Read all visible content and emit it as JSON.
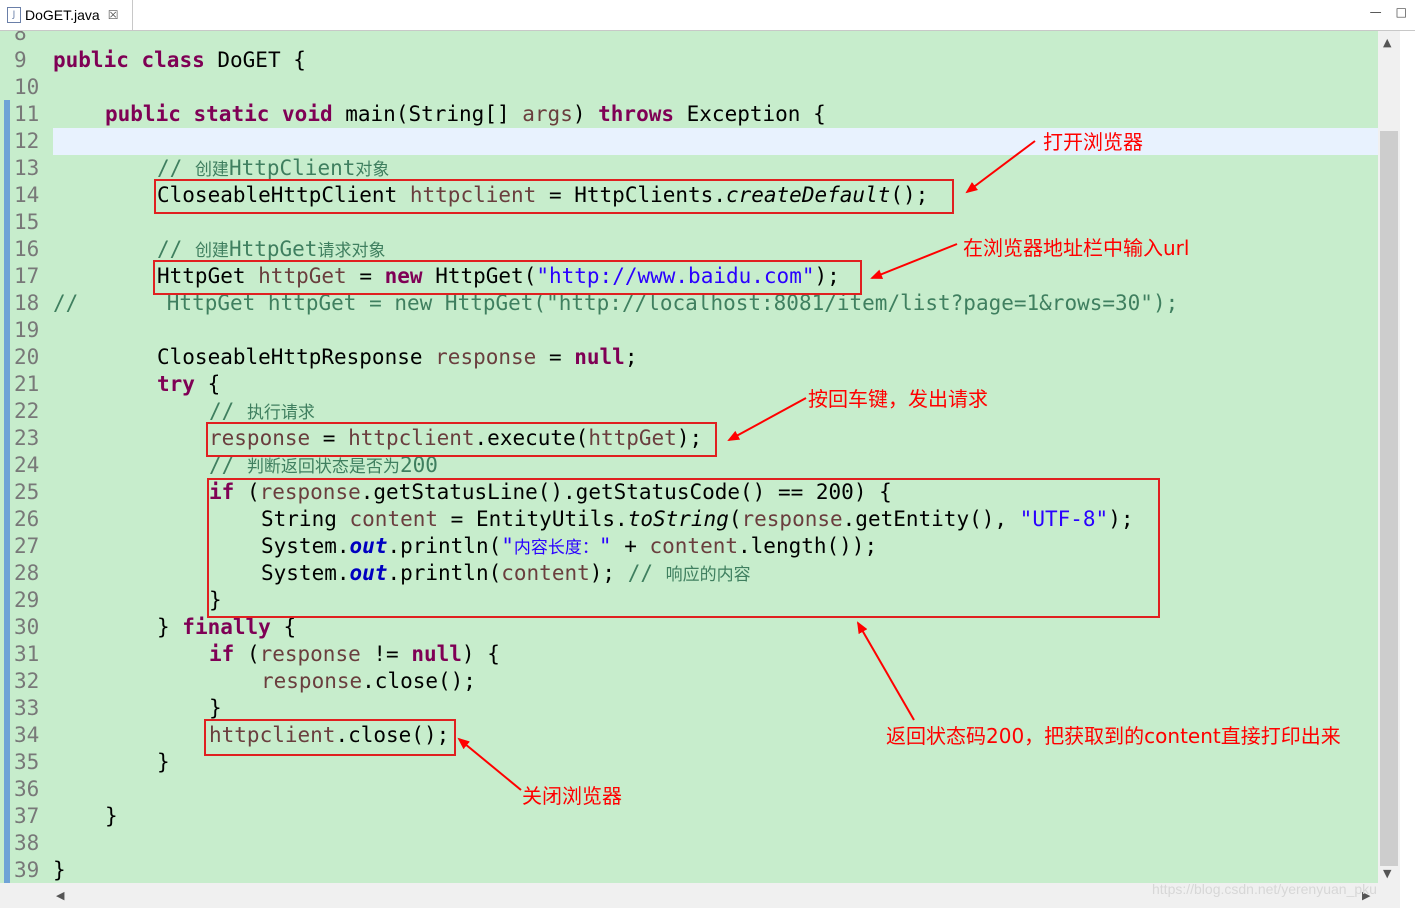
{
  "tab": {
    "title": "DoGET.java",
    "icon": "java-file-icon",
    "close": "☒"
  },
  "window_buttons": {
    "minimize": "—",
    "maximize": "□"
  },
  "line_numbers": [
    "8",
    "9",
    "10",
    "11",
    "12",
    "13",
    "14",
    "15",
    "16",
    "17",
    "18",
    "19",
    "20",
    "21",
    "22",
    "23",
    "24",
    "25",
    "26",
    "27",
    "28",
    "29",
    "30",
    "31",
    "32",
    "33",
    "34",
    "35",
    "36",
    "37",
    "38",
    "39"
  ],
  "code": {
    "l9": {
      "k1": "public",
      "k2": "class",
      "t": " DoGET {"
    },
    "l11": {
      "k1": "public",
      "k2": "static",
      "k3": "void",
      "t1": " main(String[] ",
      "v": "args",
      "t2": ") ",
      "k4": "throws",
      "t3": " Exception {"
    },
    "l13": {
      "c": "// ",
      "cjk1": "创建",
      "t": "HttpClient",
      "cjk2": "对象"
    },
    "l14": {
      "t1": "CloseableHttpClient ",
      "v": "httpclient",
      "t2": " = HttpClients.",
      "m": "createDefault",
      "t3": "();"
    },
    "l16": {
      "c": "// ",
      "cjk1": "创建",
      "t": "HttpGet",
      "cjk2": "请求对象"
    },
    "l17": {
      "t1": "HttpGet ",
      "v": "httpGet",
      "t2": " = ",
      "k": "new",
      "t3": " HttpGet(",
      "s": "\"http://www.baidu.com\"",
      "t4": ");"
    },
    "l18": {
      "c": "//       HttpGet httpGet = new HttpGet(\"http://localhost:8081/item/list?page=1&rows=30\");"
    },
    "l20": {
      "t1": "CloseableHttpResponse ",
      "v": "response",
      "t2": " = ",
      "k": "null",
      "t3": ";"
    },
    "l21": {
      "k": "try",
      "t": " {"
    },
    "l22": {
      "c": "// ",
      "cjk": "执行请求"
    },
    "l23": {
      "v1": "response",
      "t1": " = ",
      "v2": "httpclient",
      "t2": ".execute(",
      "v3": "httpGet",
      "t3": ");"
    },
    "l24": {
      "c": "// ",
      "cjk": "判断返回状态是否为",
      "t": "200"
    },
    "l25": {
      "k": "if",
      "t1": " (",
      "v": "response",
      "t2": ".getStatusLine().getStatusCode() == 200) {"
    },
    "l26": {
      "t1": "String ",
      "v1": "content",
      "t2": " = EntityUtils.",
      "m": "toString",
      "t3": "(",
      "v2": "response",
      "t4": ".getEntity(), ",
      "s": "\"UTF-8\"",
      "t5": ");"
    },
    "l27": {
      "t1": "System.",
      "f": "out",
      "t2": ".println(",
      "s1": "\"",
      "scjk": "内容长度：",
      "s2": "\"",
      "t3": " + ",
      "v": "content",
      "t4": ".length());"
    },
    "l28": {
      "t1": "System.",
      "f": "out",
      "t2": ".println(",
      "v": "content",
      "t3": "); ",
      "c": "// ",
      "cjk": "响应的内容"
    },
    "l29": {
      "t": "}"
    },
    "l30": {
      "t1": "} ",
      "k": "finally",
      "t2": " {"
    },
    "l31": {
      "k1": "if",
      "t1": " (",
      "v": "response",
      "t2": " != ",
      "k2": "null",
      "t3": ") {"
    },
    "l32": {
      "v": "response",
      "t": ".close();"
    },
    "l33": {
      "t": "}"
    },
    "l34": {
      "v": "httpclient",
      "t": ".close();"
    },
    "l35": {
      "t": "}"
    },
    "l37": {
      "t": "}"
    },
    "l39": {
      "t": "}"
    }
  },
  "annotations": {
    "open_browser": "打开浏览器",
    "enter_url": "在浏览器地址栏中输入url",
    "press_enter": "按回车键，发出请求",
    "status_200": "返回状态码200，把获取到的content直接打印出来",
    "close_browser": "关闭浏览器"
  },
  "watermark": "https://blog.csdn.net/yerenyuan_pku",
  "colors": {
    "editor_bg": "#c7edcc",
    "keyword": "#7f0055",
    "comment": "#3f7f5f",
    "string": "#2a00ff",
    "annotation": "#ff0000"
  }
}
